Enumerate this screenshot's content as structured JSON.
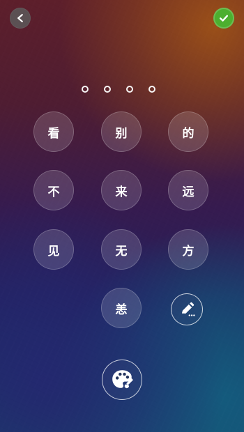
{
  "header": {
    "back_icon": "chevron-left-icon",
    "confirm_icon": "check-icon",
    "confirm_color": "#4caf2f"
  },
  "passcode": {
    "entered": 0,
    "length": 4
  },
  "keypad": {
    "keys": [
      {
        "label": "看"
      },
      {
        "label": "别"
      },
      {
        "label": "的"
      },
      {
        "label": "不"
      },
      {
        "label": "来"
      },
      {
        "label": "远"
      },
      {
        "label": "见"
      },
      {
        "label": "无"
      },
      {
        "label": "方"
      },
      {
        "label": "恙"
      }
    ]
  },
  "actions": {
    "edit_icon": "pencil-icon",
    "palette_icon": "palette-icon"
  }
}
